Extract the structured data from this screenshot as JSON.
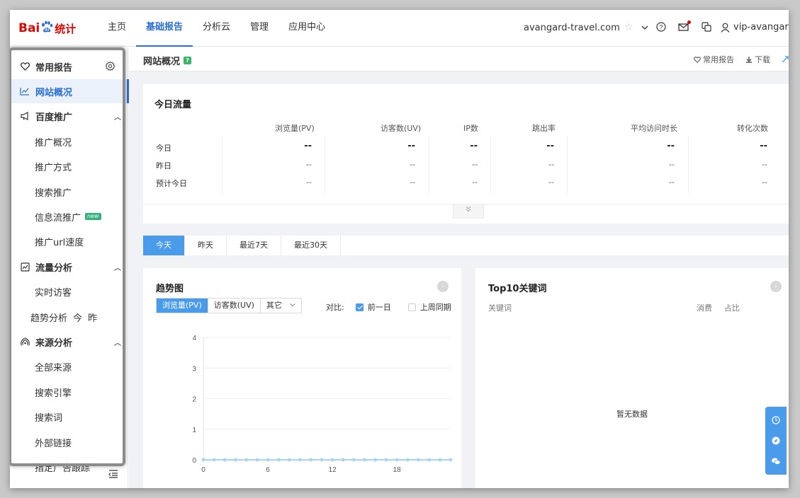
{
  "brand": {
    "text_bai": "Bai",
    "text_tj": "统计"
  },
  "nav": {
    "items": [
      "主页",
      "基础报告",
      "分析云",
      "管理",
      "应用中心"
    ],
    "active_index": 1
  },
  "site": {
    "domain": "avangard-travel.com"
  },
  "user": {
    "name": "vip-avangard"
  },
  "sidebar": {
    "common": "常用报告",
    "overview": "网站概况",
    "promo_group": "百度推广",
    "promo_items": [
      "推广概况",
      "推广方式",
      "搜索推广",
      "信息流推广",
      "推广url速度"
    ],
    "new_badge": "new",
    "traffic_group": "流量分析",
    "realtime": "实时访客",
    "trend": "趋势分析",
    "trend_today": "今",
    "trend_yesterday": "昨",
    "source_group": "来源分析",
    "source_items": [
      "全部来源",
      "搜索引擎",
      "搜索词",
      "外部链接",
      "指定广告跟踪"
    ]
  },
  "page": {
    "title": "网站概况",
    "badge": "?",
    "fav": "常用报告",
    "download": "下载"
  },
  "today_flow": {
    "title": "今日流量",
    "columns": [
      "浏览量(PV)",
      "访客数(UV)",
      "IP数",
      "跳出率",
      "平均访问时长",
      "转化次数"
    ],
    "rows": [
      {
        "label": "今日",
        "values": [
          "--",
          "--",
          "--",
          "--",
          "--",
          "--"
        ]
      },
      {
        "label": "昨日",
        "values": [
          "--",
          "--",
          "--",
          "--",
          "--",
          "--"
        ]
      },
      {
        "label": "预计今日",
        "values": [
          "--",
          "--",
          "--",
          "--",
          "--",
          "--"
        ]
      }
    ]
  },
  "day_tabs": [
    "今天",
    "昨天",
    "最近7天",
    "最近30天"
  ],
  "trend": {
    "title": "趋势图",
    "metric_tabs": [
      "浏览量(PV)",
      "访客数(UV)",
      "其它"
    ],
    "compare_label": "对比:",
    "compare_prev_day": "前一日",
    "compare_last_week": "上周同期"
  },
  "chart_data": {
    "type": "line",
    "x": [
      0,
      1,
      2,
      3,
      4,
      5,
      6,
      7,
      8,
      9,
      10,
      11,
      12,
      13,
      14,
      15,
      16,
      17,
      18,
      19,
      20,
      21,
      22,
      23
    ],
    "x_ticks": [
      "0",
      "6",
      "12",
      "18"
    ],
    "y_ticks": [
      "0",
      "1",
      "2",
      "3",
      "4"
    ],
    "ylim": [
      0,
      4
    ],
    "series": [
      {
        "values": [
          0,
          0,
          0,
          0,
          0,
          0,
          0,
          0,
          0,
          0,
          0,
          0,
          0,
          0,
          0,
          0,
          0,
          0,
          0,
          0,
          0,
          0,
          0,
          0
        ]
      }
    ],
    "color": "#a9d3f5"
  },
  "keywords": {
    "title": "Top10关键词",
    "col_keyword": "关键词",
    "col_cost": "消费",
    "col_share": "占比",
    "empty": "暂无数据"
  }
}
